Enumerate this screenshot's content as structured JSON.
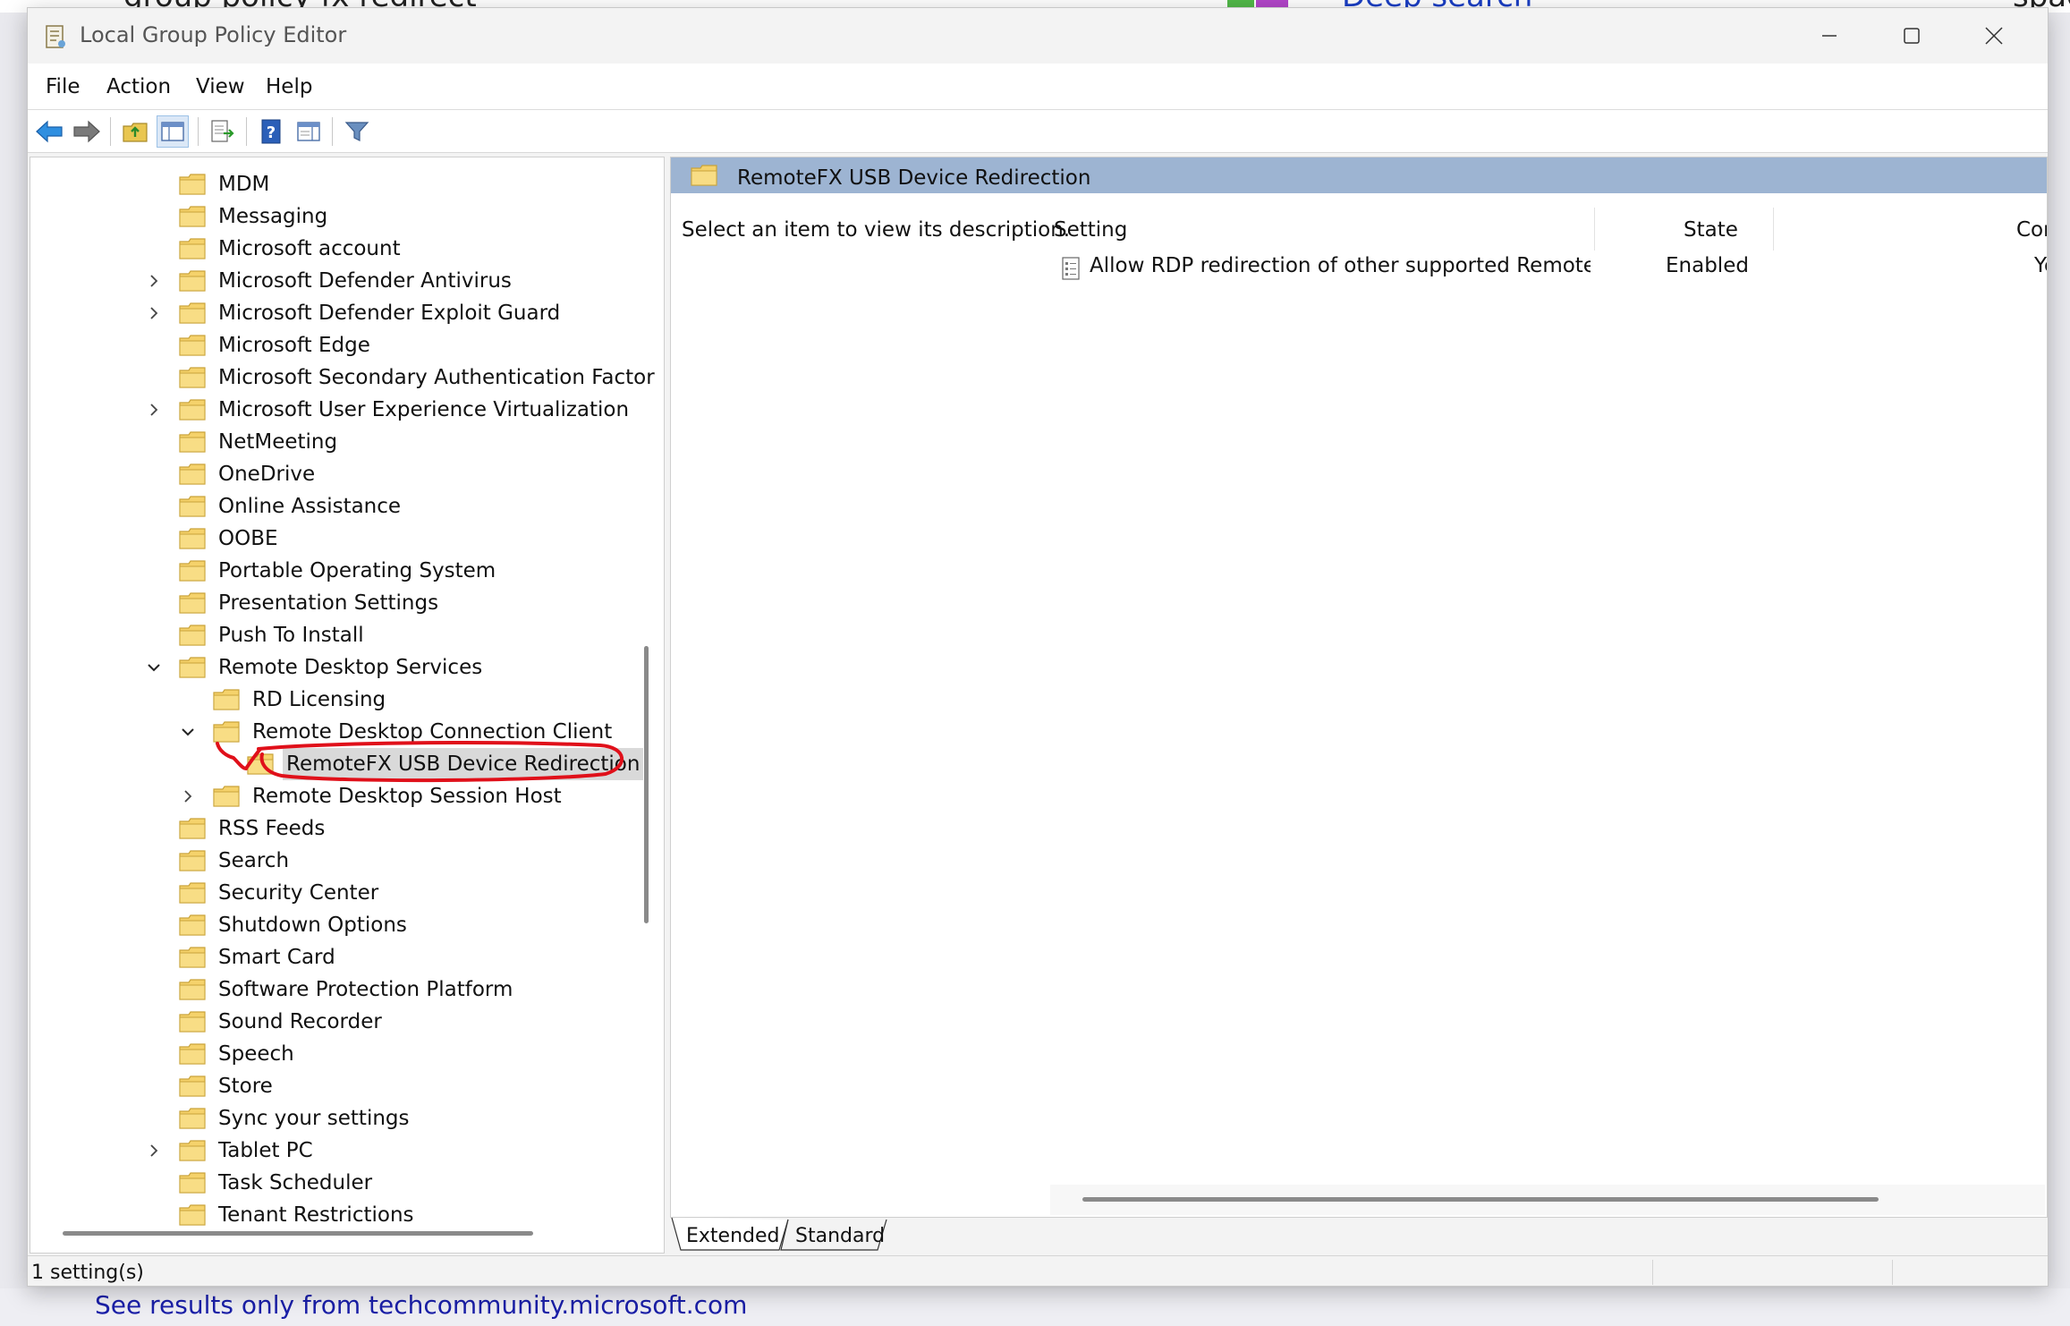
{
  "background": {
    "top_search_text": "group policy fx redirect",
    "top_link_text": "Deep search",
    "top_right_text": "spac",
    "bottom_link_text": "See results only from techcommunity.microsoft.com"
  },
  "window": {
    "title": "Local Group Policy Editor"
  },
  "menu": {
    "file": "File",
    "action": "Action",
    "view": "View",
    "help": "Help"
  },
  "tree": {
    "items": [
      {
        "label": "MDM",
        "level": 0,
        "expander": "none"
      },
      {
        "label": "Messaging",
        "level": 0,
        "expander": "none"
      },
      {
        "label": "Microsoft account",
        "level": 0,
        "expander": "none"
      },
      {
        "label": "Microsoft Defender Antivirus",
        "level": 0,
        "expander": "collapsed"
      },
      {
        "label": "Microsoft Defender Exploit Guard",
        "level": 0,
        "expander": "collapsed"
      },
      {
        "label": "Microsoft Edge",
        "level": 0,
        "expander": "none"
      },
      {
        "label": "Microsoft Secondary Authentication Factor",
        "level": 0,
        "expander": "none"
      },
      {
        "label": "Microsoft User Experience Virtualization",
        "level": 0,
        "expander": "collapsed"
      },
      {
        "label": "NetMeeting",
        "level": 0,
        "expander": "none"
      },
      {
        "label": "OneDrive",
        "level": 0,
        "expander": "none"
      },
      {
        "label": "Online Assistance",
        "level": 0,
        "expander": "none"
      },
      {
        "label": "OOBE",
        "level": 0,
        "expander": "none"
      },
      {
        "label": "Portable Operating System",
        "level": 0,
        "expander": "none"
      },
      {
        "label": "Presentation Settings",
        "level": 0,
        "expander": "none"
      },
      {
        "label": "Push To Install",
        "level": 0,
        "expander": "none"
      },
      {
        "label": "Remote Desktop Services",
        "level": 0,
        "expander": "expanded"
      },
      {
        "label": "RD Licensing",
        "level": 1,
        "expander": "none"
      },
      {
        "label": "Remote Desktop Connection Client",
        "level": 1,
        "expander": "expanded"
      },
      {
        "label": "RemoteFX USB Device Redirection",
        "level": 2,
        "expander": "none",
        "selected": true
      },
      {
        "label": "Remote Desktop Session Host",
        "level": 1,
        "expander": "collapsed"
      },
      {
        "label": "RSS Feeds",
        "level": 0,
        "expander": "none"
      },
      {
        "label": "Search",
        "level": 0,
        "expander": "none"
      },
      {
        "label": "Security Center",
        "level": 0,
        "expander": "none"
      },
      {
        "label": "Shutdown Options",
        "level": 0,
        "expander": "none"
      },
      {
        "label": "Smart Card",
        "level": 0,
        "expander": "none"
      },
      {
        "label": "Software Protection Platform",
        "level": 0,
        "expander": "none"
      },
      {
        "label": "Sound Recorder",
        "level": 0,
        "expander": "none"
      },
      {
        "label": "Speech",
        "level": 0,
        "expander": "none"
      },
      {
        "label": "Store",
        "level": 0,
        "expander": "none"
      },
      {
        "label": "Sync your settings",
        "level": 0,
        "expander": "none"
      },
      {
        "label": "Tablet PC",
        "level": 0,
        "expander": "collapsed"
      },
      {
        "label": "Task Scheduler",
        "level": 0,
        "expander": "none"
      },
      {
        "label": "Tenant Restrictions",
        "level": 0,
        "expander": "none"
      }
    ]
  },
  "details": {
    "header": "RemoteFX USB Device Redirection",
    "description": "Select an item to view its description.",
    "columns": {
      "setting": "Setting",
      "state": "State",
      "comment": "Comm"
    },
    "rows": [
      {
        "setting": "Allow RDP redirection of other supported RemoteFX USB devi...",
        "state": "Enabled",
        "comment": "Yes"
      }
    ]
  },
  "tabs": {
    "extended": "Extended",
    "standard": "Standard"
  },
  "status": {
    "text": "1 setting(s)"
  },
  "colors": {
    "header_bar": "#9db4d2",
    "folder": "#f5d26b",
    "annotation": "#e0101a"
  }
}
